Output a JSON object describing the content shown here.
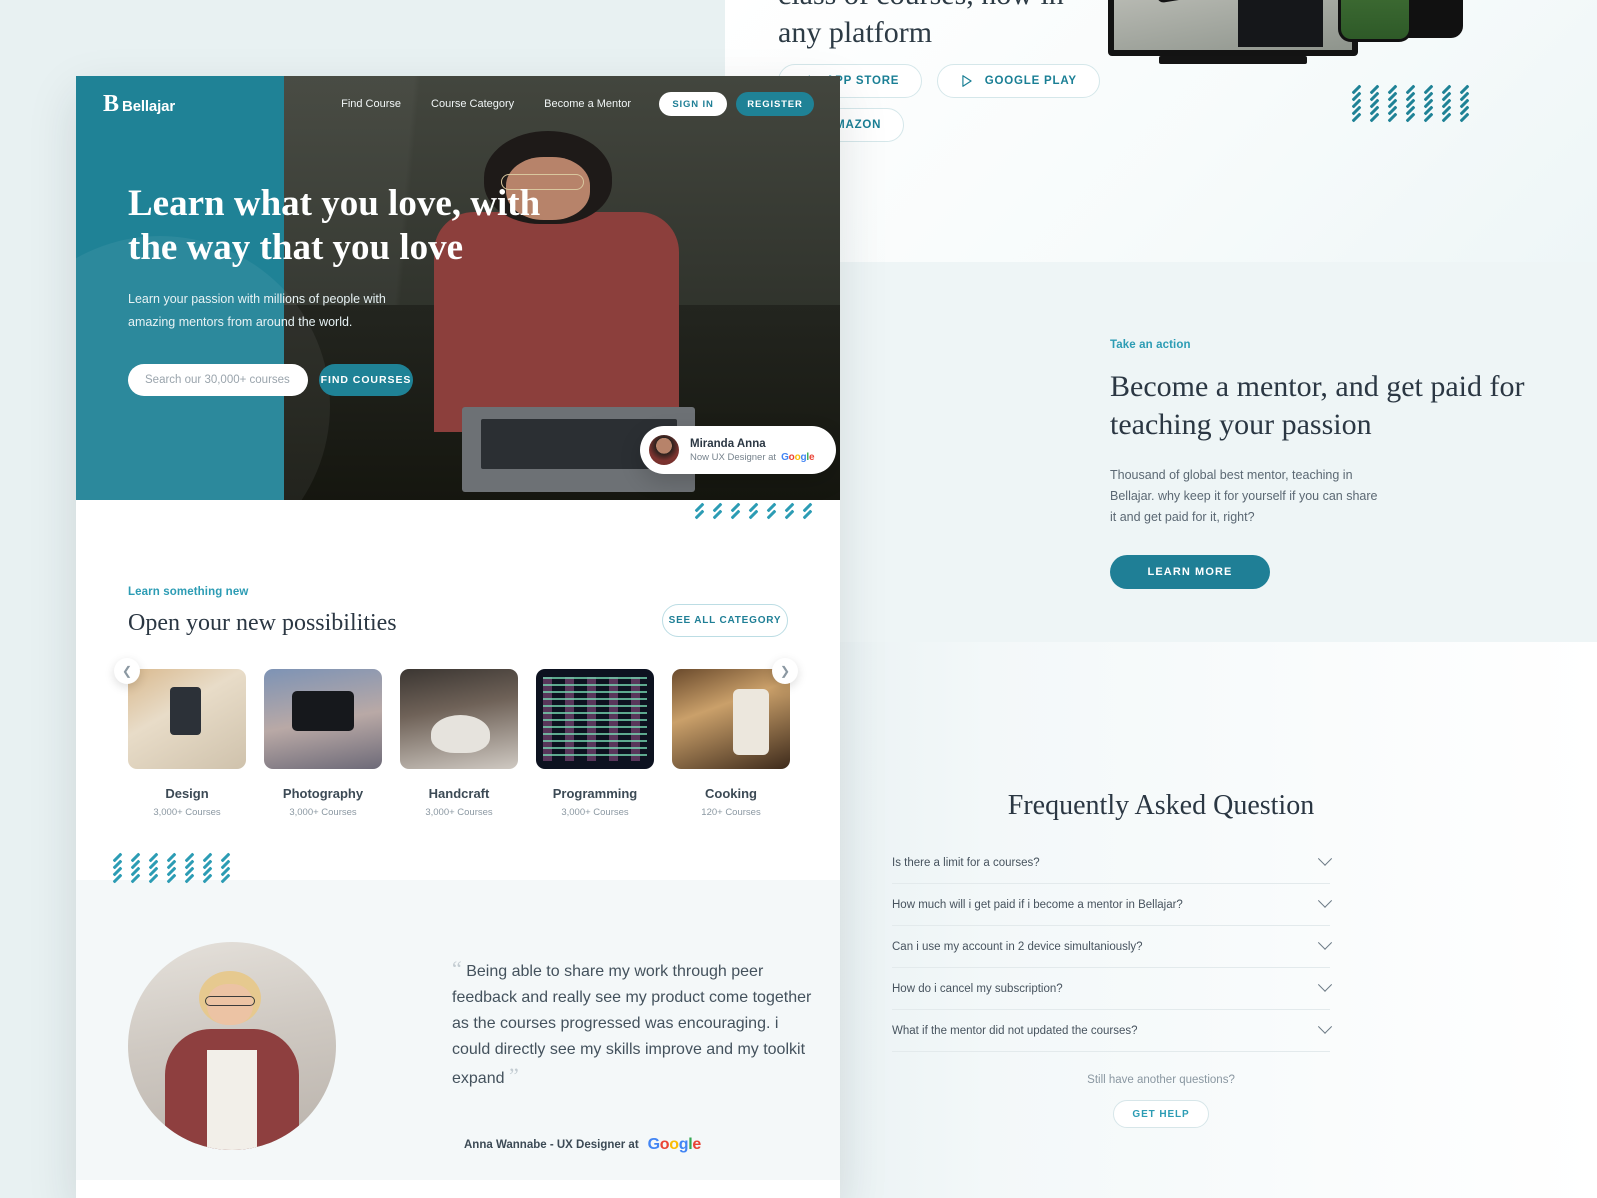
{
  "brand": {
    "mark": "B",
    "name": "Bellajar"
  },
  "nav": {
    "links": [
      "Find Course",
      "Course Category",
      "Become a Mentor"
    ],
    "signin_label": "SIGN IN",
    "register_label": "REGISTER"
  },
  "hero": {
    "headline": "Learn what you love, with the way that you love",
    "subtext": "Learn your passion with millions of people with amazing mentors from around the world.",
    "search_placeholder": "Search our 30,000+ courses",
    "search_value": "",
    "cta_label": "FIND COURSES",
    "chip": {
      "name": "Miranda Anna",
      "role": "Now UX Designer at",
      "company": "Google"
    }
  },
  "categories": {
    "eyebrow": "Learn something new",
    "title": "Open your new possibilities",
    "see_all_label": "SEE ALL CATEGORY",
    "prev_icon": "chevron-left-icon",
    "next_icon": "chevron-right-icon",
    "items": [
      {
        "name": "Design",
        "count": "3,000+ Courses"
      },
      {
        "name": "Photography",
        "count": "3,000+ Courses"
      },
      {
        "name": "Handcraft",
        "count": "3,000+ Courses"
      },
      {
        "name": "Programming",
        "count": "3,000+ Courses"
      },
      {
        "name": "Cooking",
        "count": "120+ Courses"
      }
    ]
  },
  "testimonial": {
    "open_quote": "“",
    "close_quote": "”",
    "quote": "Being able to share my work through peer feedback and really see my product come together as the courses progressed was encouraging. i could directly see my skills improve and my toolkit expand",
    "author": "Anna Wannabe - UX Designer at",
    "company": "Google"
  },
  "platform": {
    "headline": "class of courses, now in any platform",
    "buttons": [
      {
        "label": "APP STORE",
        "icon": "apple-icon"
      },
      {
        "label": "GOOGLE PLAY",
        "icon": "play-icon"
      },
      {
        "label": "AMAZON",
        "icon": "amazon-icon"
      }
    ]
  },
  "mentor": {
    "eyebrow": "Take an action",
    "headline": "Become a mentor, and get paid for teaching your passion",
    "body": "Thousand of global best mentor, teaching in Bellajar. why keep it for yourself if you can share it and get paid for it, right?",
    "cta_label": "LEARN MORE"
  },
  "faq": {
    "title": "Frequently Asked Question",
    "items": [
      "Is there a limit for a courses?",
      "How much will i get paid if i become a mentor in Bellajar?",
      "Can i use my account in 2 device simultaniously?",
      "How do i cancel my subscription?",
      "What if the mentor did not updated the courses?"
    ],
    "footer_text": "Still have another questions?",
    "help_label": "GET HELP"
  },
  "colors": {
    "teal": "#1f8296",
    "teal_light": "#2c9cb4",
    "ink": "#2b3743",
    "page_bg": "#e8f1f2"
  }
}
